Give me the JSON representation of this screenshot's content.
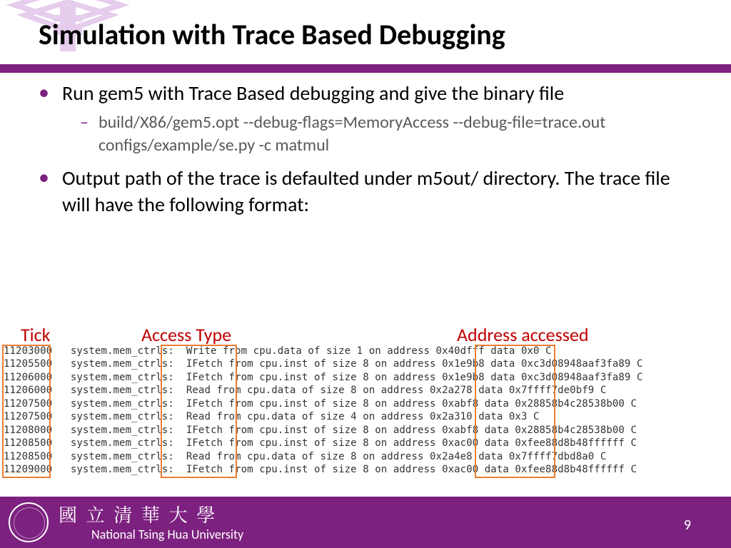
{
  "title": "Simulation with Trace Based Debugging",
  "bullets": {
    "b1a": "Run gem5 with Trace Based debugging and give the binary file",
    "b2a": "build/X86/gem5.opt --debug-flags=MemoryAccess --debug-file=trace.out configs/example/se.py -c matmul",
    "b1b": "Output path of the trace is defaulted under m5out/ directory. The trace file will have the following format:"
  },
  "annotations": {
    "tick": "Tick",
    "access_type": "Access Type",
    "address": "Address accessed"
  },
  "trace_lines": [
    "11203000   system.mem_ctrls:  Write from cpu.data of size 1 on address 0x40dfff data 0x0 C",
    "11205500   system.mem_ctrls:  IFetch from cpu.inst of size 8 on address 0x1e9b8 data 0xc3d08948aaf3fa89 C",
    "11206000   system.mem_ctrls:  IFetch from cpu.inst of size 8 on address 0x1e9b8 data 0xc3d08948aaf3fa89 C",
    "11206000   system.mem_ctrls:  Read from cpu.data of size 8 on address 0x2a278 data 0x7ffff7de0bf9 C",
    "11207500   system.mem_ctrls:  IFetch from cpu.inst of size 8 on address 0xabf8 data 0x28858b4c28538b00 C",
    "11207500   system.mem_ctrls:  Read from cpu.data of size 4 on address 0x2a310 data 0x3 C",
    "11208000   system.mem_ctrls:  IFetch from cpu.inst of size 8 on address 0xabf8 data 0x28858b4c28538b00 C",
    "11208500   system.mem_ctrls:  IFetch from cpu.inst of size 8 on address 0xac00 data 0xfee88d8b48ffffff C",
    "11208500   system.mem_ctrls:  Read from cpu.data of size 8 on address 0x2a4e8 data 0x7ffff7dbd8a0 C",
    "11209000   system.mem_ctrls:  IFetch from cpu.inst of size 8 on address 0xac00 data 0xfee88d8b48ffffff C"
  ],
  "footer": {
    "cn": "國 立 清 華 大 學",
    "en": "National Tsing Hua University",
    "page": "9"
  }
}
